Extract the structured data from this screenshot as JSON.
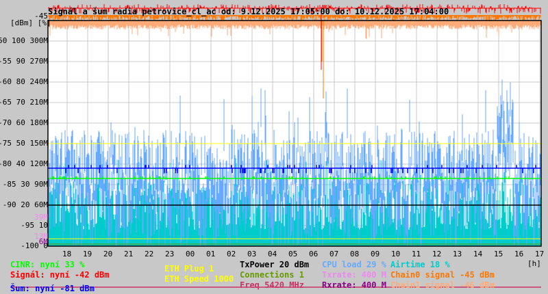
{
  "chart_data": {
    "type": "bar",
    "title": "Signál a šum radia petrovice_cl_ac od: 9.12.2025 17:05:00 do: 10.12.2025 17:04:00",
    "ylabel": "[dBm] [%]",
    "xunit": "[h]",
    "ylim": [
      -100,
      -45
    ],
    "grid": true,
    "x_ticks": [
      "18",
      "19",
      "20",
      "21",
      "22",
      "23",
      "00",
      "01",
      "02",
      "03",
      "04",
      "05",
      "06",
      "07",
      "08",
      "09",
      "10",
      "11",
      "12",
      "13",
      "14",
      "15",
      "16",
      "17"
    ],
    "y_ticks": [
      {
        "dbm": "-45",
        "pct": "",
        "rate": ""
      },
      {
        "dbm": "-50",
        "pct": "100",
        "rate": "300M"
      },
      {
        "dbm": "-55",
        "pct": "90",
        "rate": "270M"
      },
      {
        "dbm": "-60",
        "pct": "80",
        "rate": "240M"
      },
      {
        "dbm": "-65",
        "pct": "70",
        "rate": "210M"
      },
      {
        "dbm": "-70",
        "pct": "60",
        "rate": "180M"
      },
      {
        "dbm": "-75",
        "pct": "50",
        "rate": "150M"
      },
      {
        "dbm": "-80",
        "pct": "40",
        "rate": "120M"
      },
      {
        "dbm": "-85",
        "pct": "30",
        "rate": "90M"
      },
      {
        "dbm": "-90",
        "pct": "20",
        "rate": "60M"
      },
      {
        "dbm": "-95",
        "pct": "10",
        "rate": ""
      },
      {
        "dbm": "-100",
        "pct": "0",
        "rate": ""
      }
    ],
    "extra_rate_ticks": [
      {
        "label": "39M",
        "dbm": -93,
        "color": "#ee88ee"
      },
      {
        "label": "13M",
        "dbm": -97.7,
        "color": "#ee88ee"
      },
      {
        "label": "6M",
        "dbm": -99,
        "color": "#880088"
      }
    ],
    "series": [
      {
        "name": "Signál",
        "current": -42,
        "unit": "dBm",
        "color": "#ff0000"
      },
      {
        "name": "Chain0 signal",
        "current": -45,
        "unit": "dBm",
        "color": "#ff7700"
      },
      {
        "name": "Chain1 signal",
        "current": -46,
        "unit": "dBm",
        "color": "#ffaa77"
      },
      {
        "name": "Šum",
        "current": -81,
        "unit": "dBm",
        "color": "#0000ff"
      },
      {
        "name": "CINR",
        "current": 33,
        "unit": "%",
        "color": "#00ff00"
      },
      {
        "name": "CPU load",
        "current": 29,
        "unit": "%",
        "color": "#66aaff"
      },
      {
        "name": "Airtime",
        "current": 18,
        "unit": "%",
        "color": "#00cccc"
      },
      {
        "name": "ETH Speed",
        "current": 1000,
        "color": "#ffff00"
      },
      {
        "name": "TxPower",
        "current": 20,
        "unit": "dBm",
        "color": "#000000"
      },
      {
        "name": "Txrate",
        "current": 400,
        "unit": "M",
        "color": "#ee88ee"
      },
      {
        "name": "Rxrate",
        "current": 400,
        "unit": "M",
        "color": "#880088"
      }
    ]
  },
  "legend": {
    "cinr": {
      "text": "CINR: nyní 33 %",
      "color": "#00ff00"
    },
    "signal": {
      "text": "Signál: nyní -42 dBm",
      "color": "#ff0000"
    },
    "noise": {
      "text": "Šum: nyní -81 dBm",
      "color": "#0000ff"
    },
    "eth_plug": {
      "text": "ETH Plug 1",
      "color": "#ffff00"
    },
    "eth_speed": {
      "text": "ETH Speed 1000",
      "color": "#ffff00"
    },
    "txpower": {
      "text": "TxPower 20 dBm",
      "color": "#000000"
    },
    "connections": {
      "text": "Connections 1",
      "color": "#669900"
    },
    "freq": {
      "text": "Freq 5420 MHz",
      "color": "#cc3366"
    },
    "cpu": {
      "text": "CPU load 29 %",
      "color": "#66aaff"
    },
    "txrate": {
      "text": "Txrate: 400 M",
      "color": "#ee88ee"
    },
    "rxrate": {
      "text": "Rxrate: 400 M",
      "color": "#880088"
    },
    "airtime": {
      "text": "Airtime 18 %",
      "color": "#00cccc"
    },
    "chain0": {
      "text": "Chain0 signal -45 dBm",
      "color": "#ff7700"
    },
    "chain1": {
      "text": "Chain1 signal -46 dBm",
      "color": "#ffaa77"
    },
    "hunit": "[h]"
  }
}
